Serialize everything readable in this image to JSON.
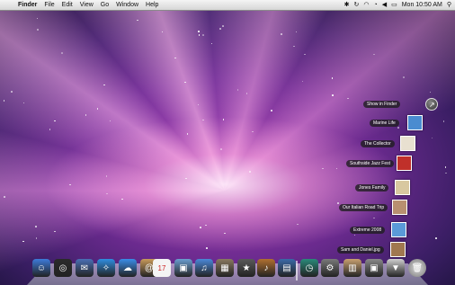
{
  "menubar": {
    "app_name": "Finder",
    "menus": [
      "File",
      "Edit",
      "View",
      "Go",
      "Window",
      "Help"
    ],
    "clock": "Mon 10:50 AM"
  },
  "stack": {
    "show_in_finder_label": "Show in Finder",
    "items": [
      {
        "label": "Marine Life",
        "thumb_color": "#4a8cd0"
      },
      {
        "label": "The Collector",
        "thumb_color": "#e8e0d0"
      },
      {
        "label": "Southside Jazz Fest",
        "thumb_color": "#c0302a"
      },
      {
        "label": "Jones Family",
        "thumb_color": "#d8c8a0"
      },
      {
        "label": "Our Italian Road Trip",
        "thumb_color": "#b89070"
      },
      {
        "label": "Extreme 2008",
        "thumb_color": "#5a9ad8"
      },
      {
        "label": "Sam and Daniel.jpg",
        "thumb_color": "#a07850"
      }
    ]
  },
  "dock": {
    "items": [
      {
        "icon": "finder-icon",
        "color": "#3d7bd9",
        "glyph": "☺"
      },
      {
        "icon": "dashboard-icon",
        "color": "#2b2b2b",
        "glyph": "◎"
      },
      {
        "icon": "mail-icon",
        "color": "#4a6fb5",
        "glyph": "✉"
      },
      {
        "icon": "safari-icon",
        "color": "#2f8de0",
        "glyph": "✧"
      },
      {
        "icon": "ichat-icon",
        "color": "#3a8de8",
        "glyph": "☁"
      },
      {
        "icon": "address-book-icon",
        "color": "#c89a5a",
        "glyph": "@"
      },
      {
        "icon": "ical-icon",
        "color": "#f0f0f0",
        "glyph": "17"
      },
      {
        "icon": "preview-icon",
        "color": "#6a9ed0",
        "glyph": "▣"
      },
      {
        "icon": "itunes-icon",
        "color": "#4a88d8",
        "glyph": "♫"
      },
      {
        "icon": "iphoto-icon",
        "color": "#8a7a60",
        "glyph": "▦"
      },
      {
        "icon": "imovie-icon",
        "color": "#5a5a5a",
        "glyph": "★"
      },
      {
        "icon": "garageband-icon",
        "color": "#b07030",
        "glyph": "♪"
      },
      {
        "icon": "spaces-icon",
        "color": "#3a6aa8",
        "glyph": "▤"
      },
      {
        "icon": "time-machine-icon",
        "color": "#2a8a7a",
        "glyph": "◷"
      },
      {
        "icon": "system-preferences-icon",
        "color": "#7a7a7a",
        "glyph": "⚙"
      },
      {
        "icon": "photos-stack-icon",
        "color": "#c8a070",
        "glyph": "▥"
      },
      {
        "icon": "applications-stack-icon",
        "color": "#8a8a8a",
        "glyph": "▣"
      },
      {
        "icon": "documents-stack-icon",
        "color": "#d0d0d0",
        "glyph": "▼"
      },
      {
        "icon": "trash-icon",
        "color": "#9a9a9a",
        "glyph": "🗑"
      }
    ]
  }
}
